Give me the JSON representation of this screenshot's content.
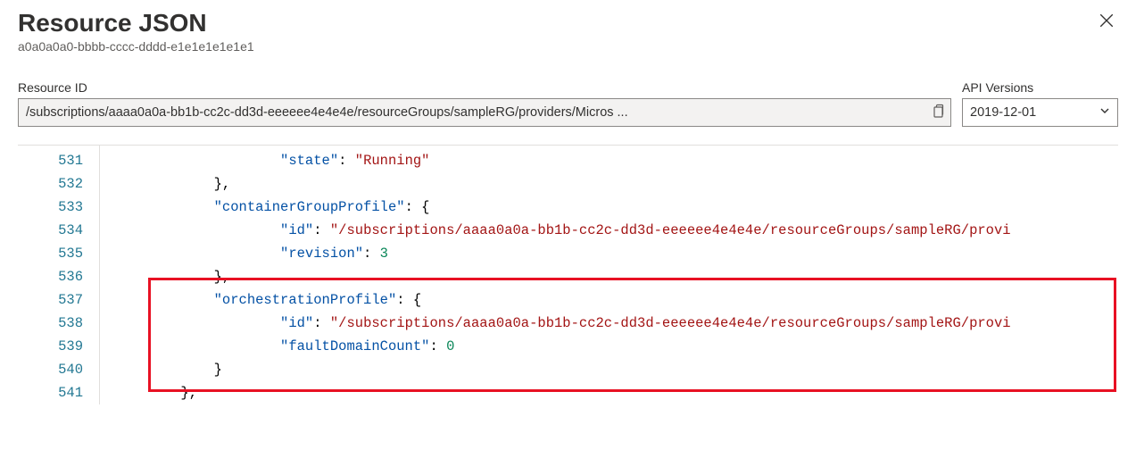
{
  "header": {
    "title": "Resource JSON",
    "subtitle": "a0a0a0a0-bbbb-cccc-dddd-e1e1e1e1e1e1"
  },
  "resourceId": {
    "label": "Resource ID",
    "value": "/subscriptions/aaaa0a0a-bb1b-cc2c-dd3d-eeeeee4e4e4e/resourceGroups/sampleRG/providers/Micros ..."
  },
  "apiVersion": {
    "label": "API Versions",
    "value": "2019-12-01"
  },
  "editor": {
    "startLine": 531,
    "lines": [
      {
        "indent": 20,
        "tokens": [
          {
            "t": "prop",
            "v": "\"state\""
          },
          {
            "t": "punc",
            "v": ": "
          },
          {
            "t": "str",
            "v": "\"Running\""
          }
        ]
      },
      {
        "indent": 12,
        "tokens": [
          {
            "t": "punc",
            "v": "},"
          }
        ]
      },
      {
        "indent": 12,
        "tokens": [
          {
            "t": "prop",
            "v": "\"containerGroupProfile\""
          },
          {
            "t": "punc",
            "v": ": {"
          }
        ]
      },
      {
        "indent": 20,
        "tokens": [
          {
            "t": "prop",
            "v": "\"id\""
          },
          {
            "t": "punc",
            "v": ": "
          },
          {
            "t": "str",
            "v": "\"/subscriptions/aaaa0a0a-bb1b-cc2c-dd3d-eeeeee4e4e4e/resourceGroups/sampleRG/provi"
          }
        ]
      },
      {
        "indent": 20,
        "tokens": [
          {
            "t": "prop",
            "v": "\"revision\""
          },
          {
            "t": "punc",
            "v": ": "
          },
          {
            "t": "num",
            "v": "3"
          }
        ]
      },
      {
        "indent": 12,
        "tokens": [
          {
            "t": "punc",
            "v": "},"
          }
        ]
      },
      {
        "indent": 12,
        "tokens": [
          {
            "t": "prop",
            "v": "\"orchestrationProfile\""
          },
          {
            "t": "punc",
            "v": ": {"
          }
        ]
      },
      {
        "indent": 20,
        "tokens": [
          {
            "t": "prop",
            "v": "\"id\""
          },
          {
            "t": "punc",
            "v": ": "
          },
          {
            "t": "str",
            "v": "\"/subscriptions/aaaa0a0a-bb1b-cc2c-dd3d-eeeeee4e4e4e/resourceGroups/sampleRG/provi"
          }
        ]
      },
      {
        "indent": 20,
        "tokens": [
          {
            "t": "prop",
            "v": "\"faultDomainCount\""
          },
          {
            "t": "punc",
            "v": ": "
          },
          {
            "t": "num",
            "v": "0"
          }
        ]
      },
      {
        "indent": 12,
        "tokens": [
          {
            "t": "punc",
            "v": "}"
          }
        ]
      },
      {
        "indent": 8,
        "tokens": [
          {
            "t": "punc",
            "v": "},"
          }
        ]
      }
    ]
  },
  "highlight": {
    "fromLine": 536,
    "toLine": 540
  }
}
